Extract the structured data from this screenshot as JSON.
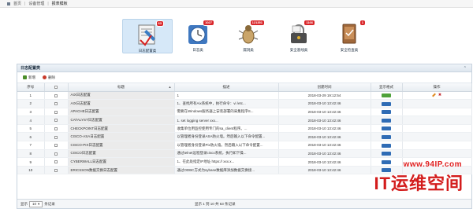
{
  "breadcrumb": {
    "items": [
      "首页",
      "设备管理",
      "报表模板"
    ]
  },
  "tiles": [
    {
      "label": "日志配置类",
      "badge": "63",
      "selected": true,
      "icon": "log-config-icon"
    },
    {
      "label": "日志类",
      "badge": "1027",
      "selected": false,
      "icon": "clock-icon"
    },
    {
      "label": "漏洞类",
      "badge": "121351",
      "selected": false,
      "icon": "bug-icon"
    },
    {
      "label": "安全基线类",
      "badge": "1166",
      "selected": false,
      "icon": "baseline-icon"
    },
    {
      "label": "安全检查类",
      "badge": "1",
      "selected": false,
      "icon": "security-check-icon"
    }
  ],
  "panel": {
    "title": "日志配置类",
    "toolbar": {
      "add": "新增",
      "delete": "删除"
    },
    "columns": [
      "序号",
      "",
      "标题",
      "描述",
      "创建时间",
      "显示格式",
      "操作"
    ],
    "rows": [
      {
        "no": "1",
        "title": "AIX日志配置",
        "desc": "1",
        "time": "2018-03-29 19:12:54",
        "format": "green"
      },
      {
        "no": "2",
        "title": "AIX日志配置",
        "desc": "1、查找所有Aix系统中，执行命令：vi /etc...",
        "time": "2018-03-10 13:42:46",
        "format": "blue"
      },
      {
        "no": "3",
        "title": "APACHE日志配置",
        "desc": "需要在Windows服务器上安装部署的采集程序S...",
        "time": "2018-03-10 13:42:46",
        "format": "blue"
      },
      {
        "no": "4",
        "title": "CATALYST日志配置",
        "desc": "1. set logging server xxx...",
        "time": "2018-03-10 13:42:46",
        "format": "blue"
      },
      {
        "no": "5",
        "title": "CHECKPOINT日志配置",
        "desc": "收集单位用监控使用专门的sa_client程序。...",
        "time": "2018-03-10 13:42:46",
        "format": "blue"
      },
      {
        "no": "6",
        "title": "CISCO-ASA日志配置",
        "desc": "以管理者身份登录ASA防火墙。然后输入以下命令配置...",
        "time": "2018-03-10 13:42:46",
        "format": "blue"
      },
      {
        "no": "7",
        "title": "CISCO-PIX日志配置",
        "desc": "以管理者身份登录Pix防火墙。然后输入以下命令配置...",
        "time": "2018-03-10 13:42:46",
        "format": "blue"
      },
      {
        "no": "8",
        "title": "CISCO日志配置",
        "desc": "通过telnet远程登录cisco系统，执行如下操...",
        "time": "2018-03-10 13:42:46",
        "format": "blue"
      },
      {
        "no": "9",
        "title": "CYBERWALL日志配置",
        "desc": "1、在此处指定IP地址 https:// xxx.x...",
        "time": "2018-03-10 13:42:46",
        "format": "blue"
      },
      {
        "no": "10",
        "title": "ERICSSON数据交换日志配置",
        "desc": "通过ODBC方式为sybase数据库添加数据交换接...",
        "time": "2018-03-10 13:42:46",
        "format": "blue"
      }
    ],
    "pager": {
      "label": "显示",
      "size": "10",
      "suffix": "条记录",
      "info": "显示 1 到 10 共 63 条记录"
    }
  },
  "watermark": {
    "url": "www.94IP.com",
    "text": "IT运维空间"
  }
}
